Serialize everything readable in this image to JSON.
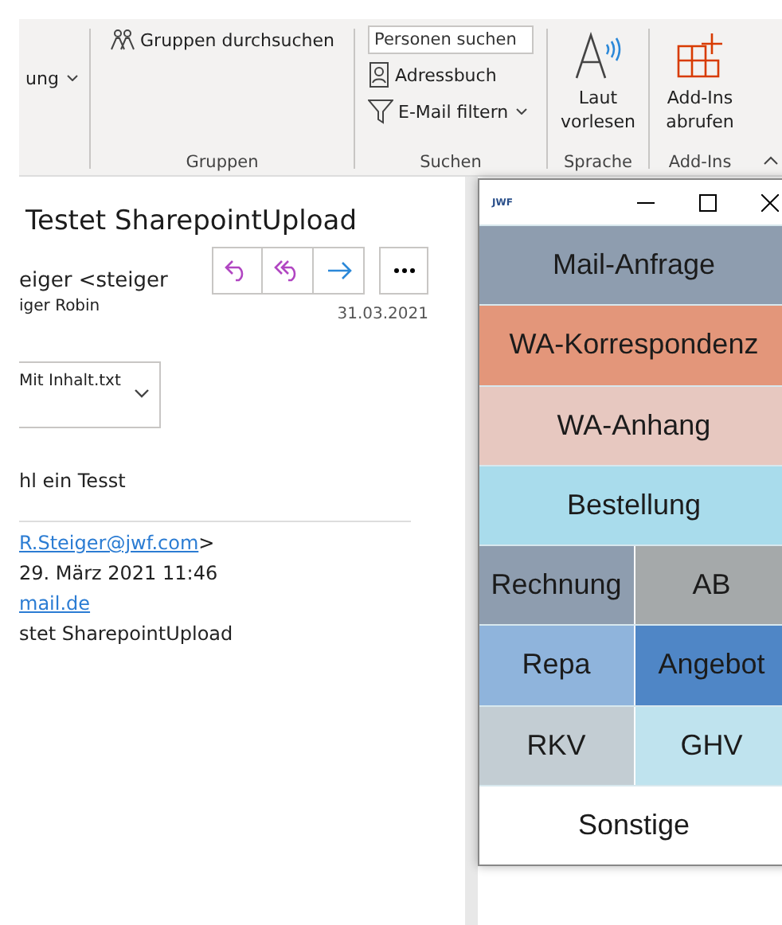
{
  "ribbon": {
    "partial_label": "ung",
    "groups": [
      {
        "kind": "gruppen",
        "label": "Gruppen",
        "button": "Gruppen durchsuchen"
      },
      {
        "kind": "suchen",
        "label": "Suchen",
        "search": {
          "placeholder": "Personen suchen"
        },
        "address_book": "Adressbuch",
        "filter": "E-Mail filtern"
      },
      {
        "kind": "sprache",
        "label": "Sprache",
        "button": "Laut vorlesen"
      },
      {
        "kind": "addins",
        "label": "Add-Ins",
        "button": "Add-Ins abrufen"
      }
    ]
  },
  "mail": {
    "subject": "Testet SharepointUpload",
    "sender": "eiger <steiger",
    "recipient": "iger Robin",
    "date": "31.03.2021",
    "attachment": "Mit Inhalt.txt",
    "body": "hl ein Tesst",
    "quoted": [
      {
        "kind": "link",
        "text": "R.Steiger@jwf.com",
        "suffix": ">"
      },
      {
        "kind": "text",
        "text": "29. März 2021 11:46"
      },
      {
        "kind": "link",
        "text": "mail.de"
      },
      {
        "kind": "text",
        "text": "stet SharepointUpload"
      }
    ]
  },
  "popup": {
    "logo": "JWF",
    "rows": [
      [
        {
          "label": "Mail-Anfrage",
          "color": "#8e9daf"
        }
      ],
      [
        {
          "label": "WA-Korrespondenz",
          "color": "#e3967a"
        }
      ],
      [
        {
          "label": "WA-Anhang",
          "color": "#e7c8c0"
        }
      ],
      [
        {
          "label": "Bestellung",
          "color": "#a9dcec"
        }
      ],
      [
        {
          "label": "Rechnung",
          "color": "#8e9daf"
        },
        {
          "label": "AB",
          "color": "#a5a9aa"
        }
      ],
      [
        {
          "label": "Repa",
          "color": "#8fb4dc"
        },
        {
          "label": "Angebot",
          "color": "#4f86c6"
        }
      ],
      [
        {
          "label": "RKV",
          "color": "#c3cdd3"
        },
        {
          "label": "GHV",
          "color": "#bfe3ee"
        }
      ],
      [
        {
          "label": "Sonstige",
          "color": "#ffffff"
        }
      ]
    ]
  }
}
